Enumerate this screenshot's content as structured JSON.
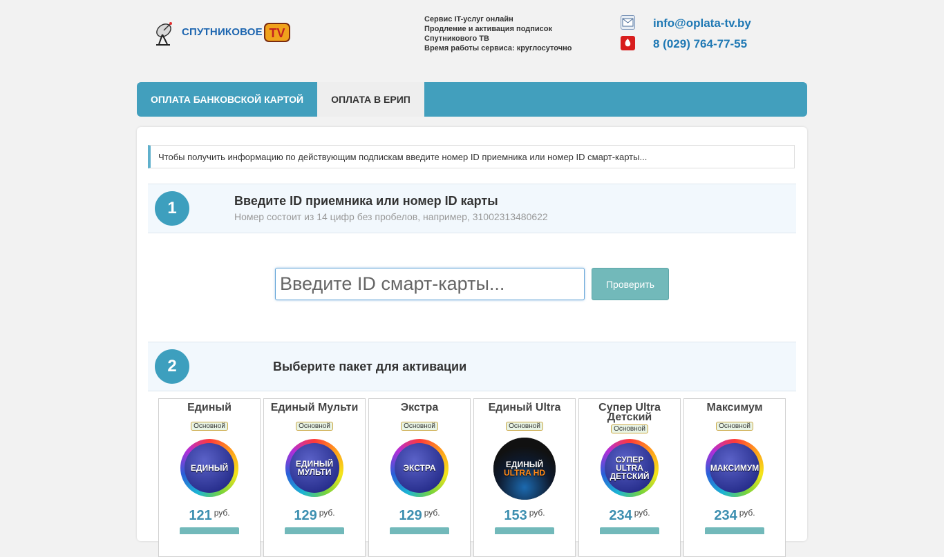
{
  "header": {
    "logo_text": "СПУТНИКОВОЕ",
    "logo_tv": "TV",
    "service_lines": [
      "Сервис IT-услуг онлайн",
      "Продление и активация подписок",
      "Спутникового ТВ",
      "Время работы сервиса: круглосуточно"
    ],
    "email": "info@oplata-tv.by",
    "phone": "8 (029) 764-77-55"
  },
  "nav": {
    "tabs": [
      {
        "label": "ОПЛАТА БАНКОВСКОЙ КАРТОЙ",
        "active": true
      },
      {
        "label": "ОПЛАТА В ЕРИП",
        "active": false
      }
    ]
  },
  "notice": "Чтобы получить информацию по действующим подпискам введите номер ID приемника или номер ID смарт-карты...",
  "step1": {
    "number": "1",
    "title": "Введите ID приемника или номер ID карты",
    "subtitle": "Номер состоит из 14 цифр без пробелов, например, 31002313480622",
    "input_placeholder": "Введите ID смарт-карты...",
    "input_value": "",
    "button_label": "Проверить"
  },
  "step2": {
    "number": "2",
    "title": "Выберите пакет для активации"
  },
  "packages": [
    {
      "name": "Единый",
      "badge": "Основной",
      "logo_lines": [
        "ЕДИНЫЙ"
      ],
      "price": "121",
      "currency": "руб."
    },
    {
      "name": "Единый Мульти",
      "badge": "Основной",
      "logo_lines": [
        "ЕДИНЫЙ",
        "МУЛЬТИ"
      ],
      "price": "129",
      "currency": "руб."
    },
    {
      "name": "Экстра",
      "badge": "Основной",
      "logo_lines": [
        "ЭКСТРА"
      ],
      "price": "129",
      "currency": "руб."
    },
    {
      "name": "Единый Ultra",
      "badge": "Основной",
      "logo_lines": [
        "ЕДИНЫЙ",
        "ULTRA HD"
      ],
      "price": "153",
      "currency": "руб."
    },
    {
      "name": "Супер Ultra Детский",
      "badge": "Основной",
      "logo_lines": [
        "СУПЕР",
        "ULTRA",
        "ДЕТСКИЙ"
      ],
      "price": "234",
      "currency": "руб."
    },
    {
      "name": "Максимум",
      "badge": "Основной",
      "logo_lines": [
        "МАКСИМУМ"
      ],
      "price": "234",
      "currency": "руб."
    }
  ],
  "colors": {
    "accent": "#429fbd",
    "button": "#72b9ba",
    "price": "#3d8fb0",
    "link": "#1e78b4"
  }
}
